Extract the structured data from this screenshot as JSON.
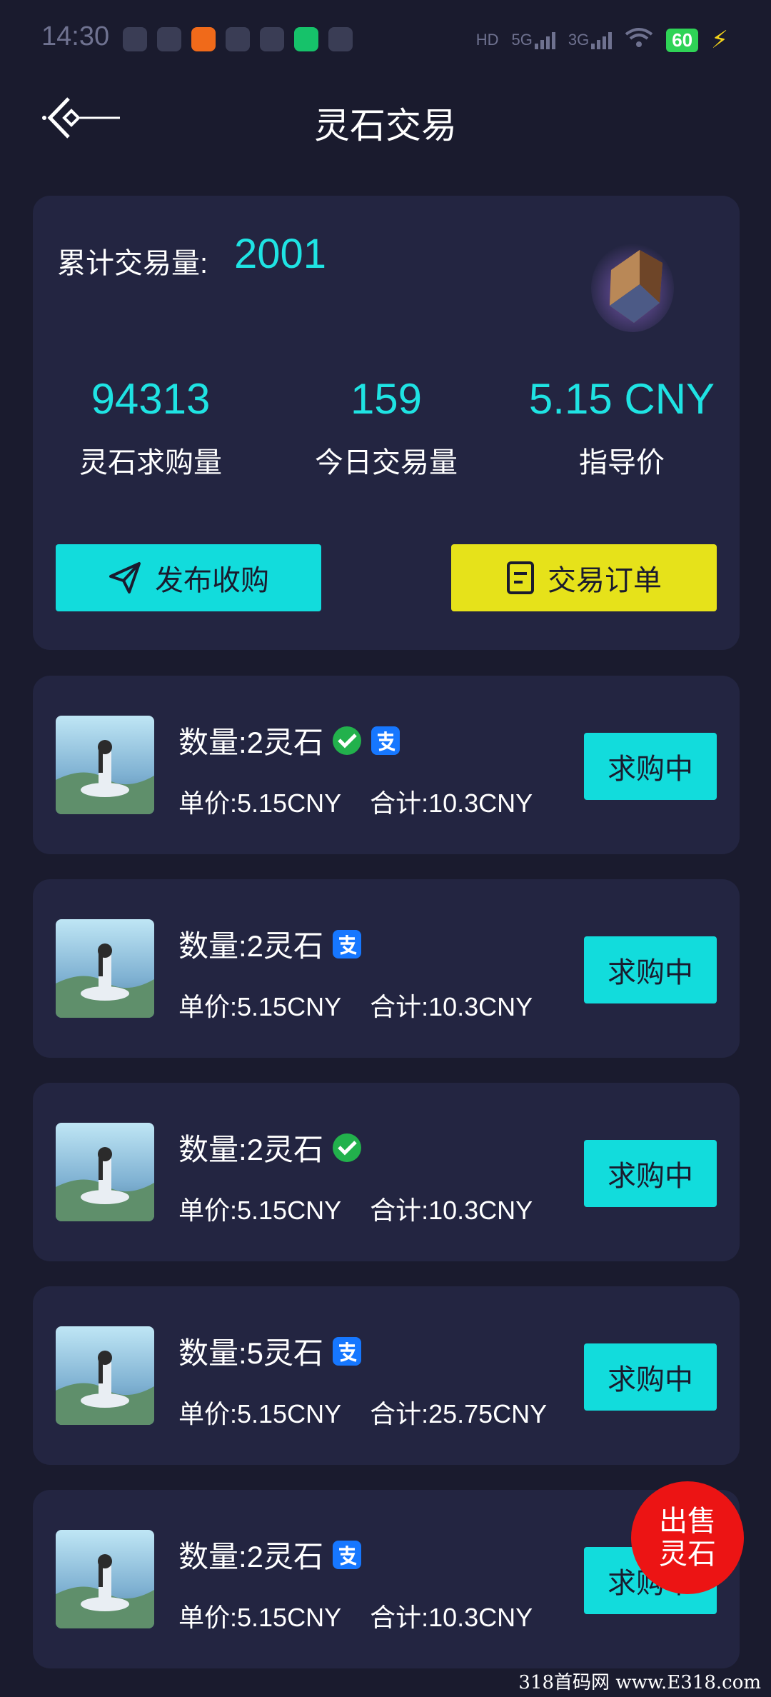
{
  "status_bar": {
    "time": "14:30",
    "battery": "60",
    "net1": "5G",
    "net2": "3G"
  },
  "header": {
    "title": "灵石交易"
  },
  "summary": {
    "total_label": "累计交易量:",
    "total_value": "2001",
    "stats": [
      {
        "value": "94313",
        "label": "灵石求购量"
      },
      {
        "value": "159",
        "label": "今日交易量"
      },
      {
        "value": "5.15 CNY",
        "label": "指导价"
      }
    ],
    "publish_button": "发布收购",
    "orders_button": "交易订单"
  },
  "orders": [
    {
      "quantity": "数量:2灵石",
      "unit_price": "单价:5.15CNY",
      "total": "合计:10.3CNY",
      "status": "求购中",
      "pay": [
        "wechat-pay",
        "alipay"
      ]
    },
    {
      "quantity": "数量:2灵石",
      "unit_price": "单价:5.15CNY",
      "total": "合计:10.3CNY",
      "status": "求购中",
      "pay": [
        "alipay"
      ]
    },
    {
      "quantity": "数量:2灵石",
      "unit_price": "单价:5.15CNY",
      "total": "合计:10.3CNY",
      "status": "求购中",
      "pay": [
        "wechat-pay"
      ]
    },
    {
      "quantity": "数量:5灵石",
      "unit_price": "单价:5.15CNY",
      "total": "合计:25.75CNY",
      "status": "求购中",
      "pay": [
        "alipay"
      ]
    },
    {
      "quantity": "数量:2灵石",
      "unit_price": "单价:5.15CNY",
      "total": "合计:10.3CNY",
      "status": "求购中",
      "pay": [
        "alipay"
      ]
    }
  ],
  "fab": {
    "line1": "出售",
    "line2": "灵石"
  },
  "watermark": "318首码网 www.E318.com",
  "colors": {
    "background": "#1a1b2e",
    "card": "#232541",
    "accent_cyan": "#12dcdc",
    "accent_yellow": "#e6e21a",
    "fab_red": "#ec1414"
  }
}
